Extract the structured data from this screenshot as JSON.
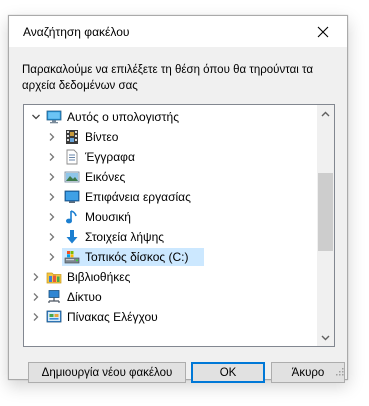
{
  "dialog": {
    "title": "Αναζήτηση φακέλου",
    "close_icon": "close-icon",
    "instruction": "Παρακαλούμε να επιλέξετε τη θέση όπου θα τηρούνται τα αρχεία δεδομένων σας"
  },
  "tree": {
    "items": [
      {
        "label": "Αυτός ο υπολογιστής",
        "icon": "computer-icon",
        "expanded": true
      },
      {
        "label": "Βίντεο",
        "icon": "videos-folder-icon"
      },
      {
        "label": "Έγγραφα",
        "icon": "documents-folder-icon"
      },
      {
        "label": "Εικόνες",
        "icon": "pictures-folder-icon"
      },
      {
        "label": "Επιφάνεια εργασίας",
        "icon": "desktop-folder-icon"
      },
      {
        "label": "Μουσική",
        "icon": "music-folder-icon"
      },
      {
        "label": "Στοιχεία λήψης",
        "icon": "downloads-folder-icon"
      },
      {
        "label": "Τοπικός δίσκος (C:)",
        "icon": "local-disk-icon",
        "selected": true
      },
      {
        "label": "Βιβλιοθήκες",
        "icon": "libraries-icon"
      },
      {
        "label": "Δίκτυο",
        "icon": "network-icon"
      },
      {
        "label": "Πίνακας Ελέγχου",
        "icon": "control-panel-icon"
      }
    ]
  },
  "buttons": {
    "new_folder": "Δημιουργία νέου φακέλου",
    "ok": "OK",
    "cancel": "Άκυρο"
  },
  "colors": {
    "selection": "#cce8ff",
    "accent": "#0078d7",
    "dialog_bg": "#f0f0f0"
  }
}
